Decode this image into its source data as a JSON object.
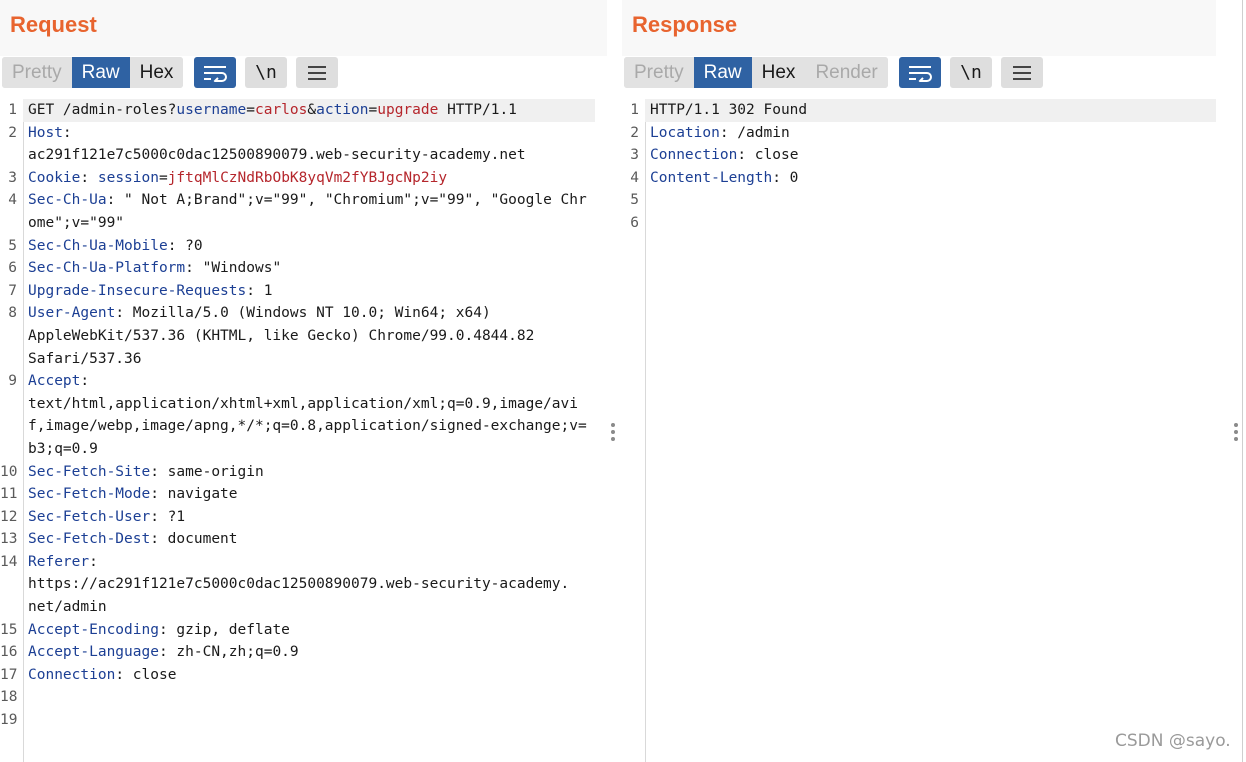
{
  "request": {
    "title": "Request",
    "tabs": [
      "Pretty",
      "Raw",
      "Hex"
    ],
    "active_tab": "Raw",
    "newline_label": "\\n",
    "lines": [
      {
        "n": "1",
        "parts": [
          [
            "GET /admin-roles?",
            ""
          ],
          [
            "username",
            "pn"
          ],
          [
            "=",
            ""
          ],
          [
            "carlos",
            "pv"
          ],
          [
            "&",
            ""
          ],
          [
            "action",
            "pn"
          ],
          [
            "=",
            ""
          ],
          [
            "upgrade",
            "pv"
          ],
          [
            " HTTP/1.1",
            ""
          ]
        ]
      },
      {
        "n": "2",
        "parts": [
          [
            "Host",
            "hn"
          ],
          [
            ":\nac291f121e7c5000c0dac12500890079.web-security-academy.net",
            ""
          ]
        ]
      },
      {
        "n": "3",
        "parts": [
          [
            "Cookie",
            "hn"
          ],
          [
            ": ",
            ""
          ],
          [
            "session",
            "pn"
          ],
          [
            "=",
            ""
          ],
          [
            "jftqMlCzNdRbObK8yqVm2fYBJgcNp2iy",
            "pv"
          ]
        ]
      },
      {
        "n": "4",
        "parts": [
          [
            "Sec-Ch-Ua",
            "hn"
          ],
          [
            ": \" Not A;Brand\";v=\"99\", \"Chromium\";v=\"99\", \"Google Chrome\";v=\"99\"",
            ""
          ]
        ]
      },
      {
        "n": "5",
        "parts": [
          [
            "Sec-Ch-Ua-Mobile",
            "hn"
          ],
          [
            ": ?0",
            ""
          ]
        ]
      },
      {
        "n": "6",
        "parts": [
          [
            "Sec-Ch-Ua-Platform",
            "hn"
          ],
          [
            ": \"Windows\"",
            ""
          ]
        ]
      },
      {
        "n": "7",
        "parts": [
          [
            "Upgrade-Insecure-Requests",
            "hn"
          ],
          [
            ": 1",
            ""
          ]
        ]
      },
      {
        "n": "8",
        "parts": [
          [
            "User-Agent",
            "hn"
          ],
          [
            ": Mozilla/5.0 (Windows NT 10.0; Win64; x64)\nAppleWebKit/537.36 (KHTML, like Gecko) Chrome/99.0.4844.82\nSafari/537.36",
            ""
          ]
        ]
      },
      {
        "n": "9",
        "parts": [
          [
            "Accept",
            "hn"
          ],
          [
            ":\ntext/html,application/xhtml+xml,application/xml;q=0.9,image/avif,image/webp,image/apng,*/*;q=0.8,application/signed-exchange;v=b3;q=0.9",
            ""
          ]
        ]
      },
      {
        "n": "10",
        "parts": [
          [
            "Sec-Fetch-Site",
            "hn"
          ],
          [
            ": same-origin",
            ""
          ]
        ]
      },
      {
        "n": "11",
        "parts": [
          [
            "Sec-Fetch-Mode",
            "hn"
          ],
          [
            ": navigate",
            ""
          ]
        ]
      },
      {
        "n": "12",
        "parts": [
          [
            "Sec-Fetch-User",
            "hn"
          ],
          [
            ": ?1",
            ""
          ]
        ]
      },
      {
        "n": "13",
        "parts": [
          [
            "Sec-Fetch-Dest",
            "hn"
          ],
          [
            ": document",
            ""
          ]
        ]
      },
      {
        "n": "14",
        "parts": [
          [
            "Referer",
            "hn"
          ],
          [
            ":\nhttps://ac291f121e7c5000c0dac12500890079.web-security-academy.\nnet/admin",
            ""
          ]
        ]
      },
      {
        "n": "15",
        "parts": [
          [
            "Accept-Encoding",
            "hn"
          ],
          [
            ": gzip, deflate",
            ""
          ]
        ]
      },
      {
        "n": "16",
        "parts": [
          [
            "Accept-Language",
            "hn"
          ],
          [
            ": zh-CN,zh;q=0.9",
            ""
          ]
        ]
      },
      {
        "n": "17",
        "parts": [
          [
            "Connection",
            "hn"
          ],
          [
            ": close",
            ""
          ]
        ]
      },
      {
        "n": "18",
        "parts": [
          [
            "",
            ""
          ]
        ]
      },
      {
        "n": "19",
        "parts": [
          [
            "",
            ""
          ]
        ]
      }
    ]
  },
  "response": {
    "title": "Response",
    "tabs": [
      "Pretty",
      "Raw",
      "Hex",
      "Render"
    ],
    "active_tab": "Raw",
    "newline_label": "\\n",
    "lines": [
      {
        "n": "1",
        "parts": [
          [
            "HTTP/1.1 302 Found",
            ""
          ]
        ]
      },
      {
        "n": "2",
        "parts": [
          [
            "Location",
            "hn"
          ],
          [
            ": /admin",
            ""
          ]
        ]
      },
      {
        "n": "3",
        "parts": [
          [
            "Connection",
            "hn"
          ],
          [
            ": close",
            ""
          ]
        ]
      },
      {
        "n": "4",
        "parts": [
          [
            "Content-Length",
            "hn"
          ],
          [
            ": 0",
            ""
          ]
        ]
      },
      {
        "n": "5",
        "parts": [
          [
            "",
            ""
          ]
        ]
      },
      {
        "n": "6",
        "parts": [
          [
            "",
            ""
          ]
        ]
      }
    ]
  },
  "icons": {
    "wrap": "word-wrap-icon",
    "newline": "show-newlines-icon",
    "menu": "menu-icon",
    "layout_side": "layout-side-by-side-icon",
    "layout_top": "layout-top-bottom-icon",
    "layout_tabs": "layout-tabs-icon"
  },
  "colors": {
    "title": "#e8642f",
    "active_tab": "#2f62a3",
    "header_name": "#1c3f94",
    "param_value": "#b5262c"
  },
  "watermark": "CSDN @sayo."
}
